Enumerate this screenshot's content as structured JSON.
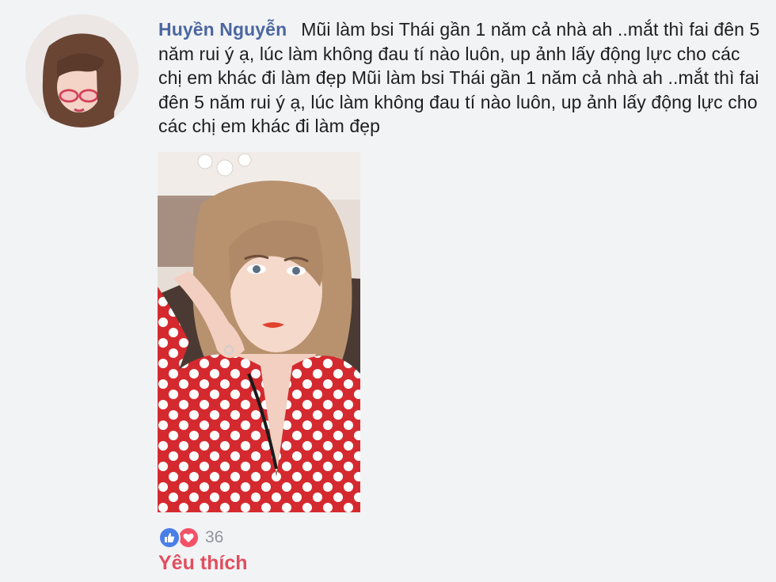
{
  "comment": {
    "author_name": "Huyền Nguyễn",
    "text": "Mũi làm bsi Thái gần 1 năm cả nhà ah ..mắt thì fai đên 5 năm rui ý ạ, lúc làm không đau tí nào luôn, up ảnh lấy động lực cho các chị em khác đi làm đẹp Mũi làm bsi Thái gần 1 năm cả nhà ah ..mắt thì fai đên 5 năm rui ý ạ, lúc làm không đau tí nào luôn, up ảnh lấy động lực cho các chị em khác đi làm đẹp"
  },
  "reactions": {
    "icons": [
      "like-icon",
      "heart-icon"
    ],
    "count": "36",
    "like_color": "#4a7fe8",
    "love_color": "#f25268"
  },
  "actions": {
    "like_label": "Yêu thích",
    "like_color": "#e04f5f"
  },
  "colors": {
    "author": "#4b67a1",
    "background": "#f2f3f5",
    "text": "#1c1e21"
  }
}
